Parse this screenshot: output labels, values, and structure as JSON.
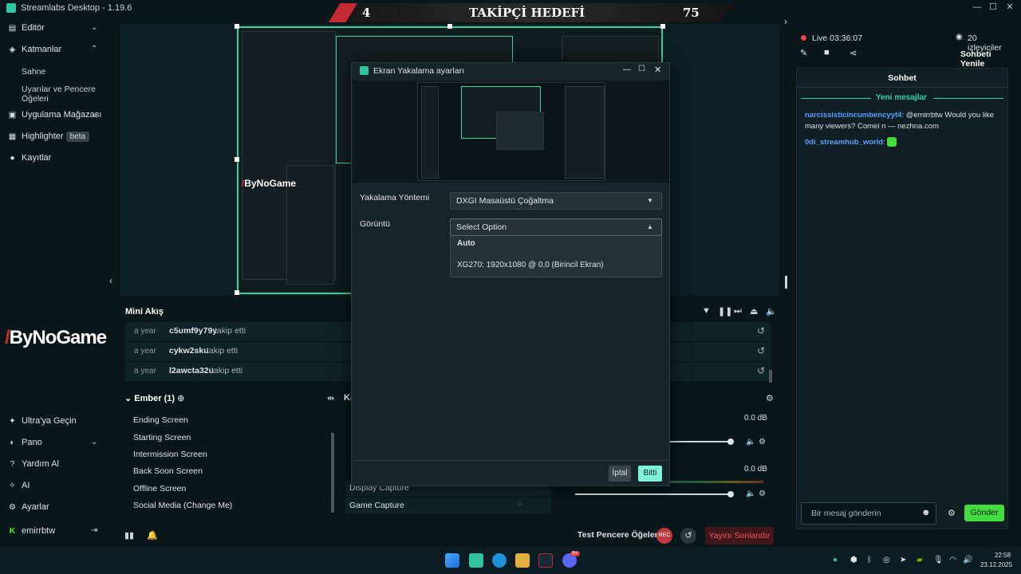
{
  "window": {
    "title": "Streamlabs Desktop - 1.19.6"
  },
  "goal": {
    "current": "4",
    "title": "TAKİPÇİ HEDEFİ",
    "target": "75"
  },
  "sidebar": {
    "items": [
      {
        "label": "Editör",
        "icon": "editor-icon"
      },
      {
        "label": "Katmanlar",
        "icon": "layers-icon"
      },
      {
        "label": "Uygulama Mağazası",
        "icon": "app-store-icon"
      },
      {
        "label": "Highlighter",
        "badge": "beta",
        "icon": "highlighter-icon"
      },
      {
        "label": "Kayıtlar",
        "icon": "recordings-icon"
      }
    ],
    "sub_items": [
      "Sahne",
      "Uyarılar ve Pencere Öğeleri"
    ],
    "bottom_items": [
      {
        "label": "Ultra'ya Geçin",
        "icon": "ultra-icon"
      },
      {
        "label": "Pano",
        "icon": "dashboard-icon"
      },
      {
        "label": "Yardım Al",
        "icon": "help-icon"
      },
      {
        "label": "AI",
        "icon": "ai-icon"
      },
      {
        "label": "Ayarlar",
        "icon": "settings-icon"
      }
    ],
    "user": "emirrbtw"
  },
  "brand": {
    "bynogame": "ByNoGame"
  },
  "minifeed": {
    "title": "Mini Akış",
    "rows": [
      {
        "age": "a year",
        "user": "c5umf9y79y",
        "action": "takip etti"
      },
      {
        "age": "a year",
        "user": "cykw2sku",
        "action": "takip etti"
      },
      {
        "age": "a year",
        "user": "l2awcta32u",
        "action": "takip etti"
      }
    ]
  },
  "scenes": {
    "title": "Ember (1)",
    "list": [
      "Ending Screen",
      "Starting Screen",
      "Intermission Screen",
      "Back Soon Screen",
      "Offline Screen",
      "Social Media (Change Me)"
    ]
  },
  "sources": {
    "title_partial": "Ka",
    "list": [
      "Display Capture",
      "Game Capture"
    ]
  },
  "mixer": {
    "levels": [
      "0.0 dB",
      "0.0 dB"
    ]
  },
  "bottombar": {
    "test_widgets": "Test Pencere Öğeleri",
    "end_stream": "Yayını Sonlandır",
    "rec": "REC"
  },
  "stream": {
    "live_label": "Live 03:36:07",
    "viewers": "20 izleyiciler",
    "refresh_chat": "Sohbeti Yenile"
  },
  "chat": {
    "title": "Sohbet",
    "new_messages": "Yeni mesajlar",
    "messages": [
      {
        "user": "narcissisticincumbencyyt4",
        "text": ": @emirrbtw Would you like many viewers? Comei n — nezhna.com"
      },
      {
        "user": "0di_streamhub_world",
        "text": ":"
      }
    ],
    "input_placeholder": "Bir mesaj gönderin",
    "send": "Gönder"
  },
  "modal": {
    "title": "Ekran Yakalama ayarları",
    "method_label": "Yakalama Yöntemi",
    "method_value": "DXGI Masaüstü Çoğaltma",
    "display_label": "Görüntü",
    "display_placeholder": "Select Option",
    "options": [
      "Auto",
      "XG270: 1920x1080 @ 0,0 (Birincil Ekran)"
    ],
    "cancel": "İptal",
    "done": "Bitti"
  },
  "taskbar": {
    "time": "22:58",
    "date": "23.12.2025",
    "discord_badge": "9+"
  },
  "colors": {
    "accent": "#31c3a2",
    "scene_border": "#2fd4a5",
    "send_green": "#44dd3f",
    "end_red": "#f0555e",
    "goal_red": "#c22a34"
  }
}
